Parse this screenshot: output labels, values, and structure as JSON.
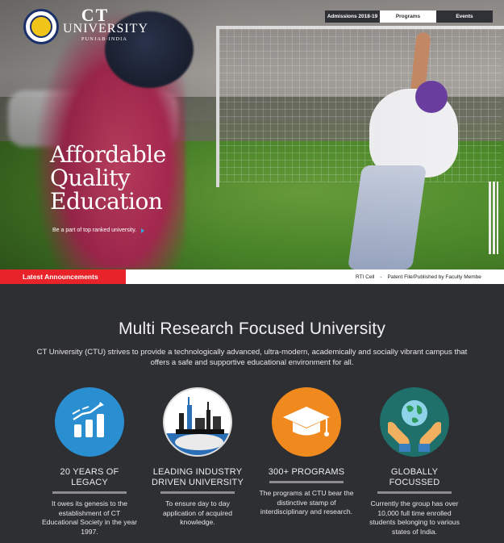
{
  "brand": {
    "name_top": "CT",
    "name_bottom": "UNIVERSITY",
    "location": "PUNJAB·INDIA",
    "emblem_text": "CT UNIVERSITY"
  },
  "nav": {
    "admissions": "Admissions 2018-19",
    "programs": "Programs",
    "events": "Events"
  },
  "hero": {
    "headline_1": "Affordable",
    "headline_2": "Quality",
    "headline_3": "Education",
    "tagline": "Be a part of top ranked university."
  },
  "announcements": {
    "label": "Latest Announcements",
    "item_1": "RTI Cell",
    "separator": "-",
    "item_2": "Patent File/Published by Faculty Membe"
  },
  "main": {
    "title": "Multi Research Focused University",
    "description": "CT University (CTU) strives to provide a technologically advanced, ultra-modern, academically and socially vibrant campus that offers a safe and supportive educational environment for all."
  },
  "features": [
    {
      "title": "20 YEARS OF LEGACY",
      "desc": "It owes its genesis to the establishment of CT Educational Society in the year 1997."
    },
    {
      "title": "LEADING INDUSTRY DRIVEN UNIVERSITY",
      "desc": "To ensure day to day application of acquired knowledge."
    },
    {
      "title": "300+ PROGRAMS",
      "desc": "The programs at CTU bear the distinctive stamp of interdisciplinary and research."
    },
    {
      "title": "GLOBALLY FOCUSSED",
      "desc": "Currently the group has over 10,000 full time enrolled students belonging to various states of India."
    }
  ],
  "colors": {
    "accent_blue": "#35a9e0",
    "announce_red": "#e8242a",
    "dark_bg": "#2e2f33",
    "icon_blue": "#2a8fd0",
    "icon_orange": "#f08a1e",
    "icon_teal": "#1f6f6a"
  },
  "icons": [
    "growth-chart-icon",
    "industry-icon",
    "graduation-cap-icon",
    "globe-hands-icon"
  ]
}
